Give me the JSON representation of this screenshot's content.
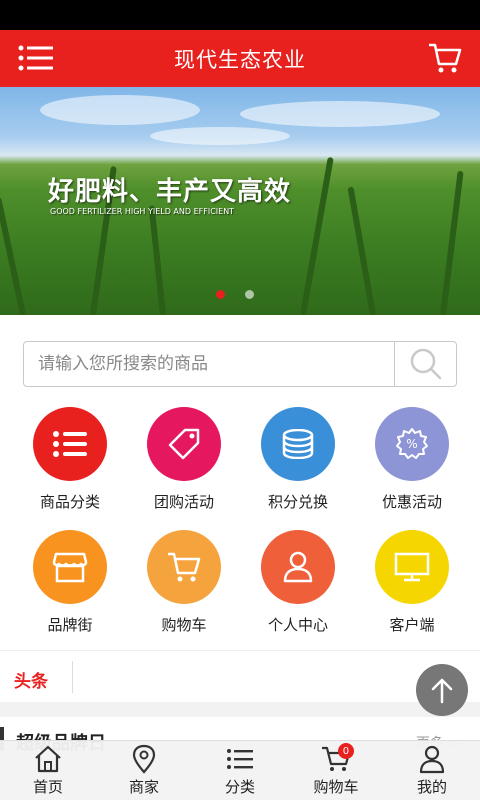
{
  "header": {
    "title": "现代生态农业",
    "menu_icon": "hamburger-menu-icon",
    "cart_icon": "cart-icon"
  },
  "banner": {
    "headline": "好肥料、丰产又高效",
    "subline": "GOOD FERTILIZER HIGH YIELD AND EFFICIENT",
    "slide_count": 2,
    "active_slide": 1
  },
  "search": {
    "placeholder": "请输入您所搜索的商品",
    "icon": "search-icon"
  },
  "grid": [
    {
      "label": "商品分类",
      "icon": "list-icon",
      "color": "#e8211f"
    },
    {
      "label": "团购活动",
      "icon": "tag-icon",
      "color": "#e4175f"
    },
    {
      "label": "积分兑换",
      "icon": "coins-icon",
      "color": "#3a8fd9"
    },
    {
      "label": "优惠活动",
      "icon": "discount-icon",
      "color": "#8e95d6"
    },
    {
      "label": "品牌街",
      "icon": "store-icon",
      "color": "#f7931e"
    },
    {
      "label": "购物车",
      "icon": "cart-icon",
      "color": "#f5a33d"
    },
    {
      "label": "个人中心",
      "icon": "person-icon",
      "color": "#ef5f3a"
    },
    {
      "label": "客户端",
      "icon": "monitor-icon",
      "color": "#f5d600"
    }
  ],
  "news": {
    "tag": "头条"
  },
  "brand": {
    "title": "超级品牌日",
    "more": "更多 >"
  },
  "tabbar": [
    {
      "label": "首页",
      "icon": "home-icon"
    },
    {
      "label": "商家",
      "icon": "location-pin-icon"
    },
    {
      "label": "分类",
      "icon": "list-icon"
    },
    {
      "label": "购物车",
      "icon": "cart-icon",
      "badge": "0"
    },
    {
      "label": "我的",
      "icon": "person-icon"
    }
  ]
}
